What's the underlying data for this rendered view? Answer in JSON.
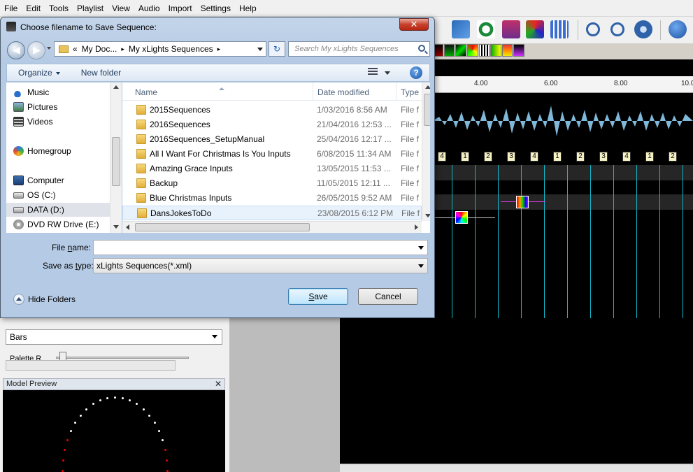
{
  "menubar": {
    "items": [
      "File",
      "Edit",
      "Tools",
      "Playlist",
      "View",
      "Audio",
      "Import",
      "Settings",
      "Help"
    ]
  },
  "timeline": {
    "ruler_labels": [
      "4.00",
      "6.00",
      "8.00",
      "10.0"
    ],
    "timing_marks": [
      "4",
      "1",
      "2",
      "3",
      "4",
      "1",
      "2",
      "3",
      "4",
      "1",
      "2",
      "3"
    ]
  },
  "effect_settings": {
    "effect_type": "Bars",
    "palette_label": "Palette R"
  },
  "model_preview": {
    "title": "Model Preview",
    "close": "✕"
  },
  "dialog": {
    "title": "Choose filename to Save Sequence:",
    "close_glyph": "✕",
    "back_glyph": "◀",
    "fwd_glyph": "▶",
    "address": {
      "overflow": "«",
      "parts": [
        "My Doc...",
        "My xLights Sequences"
      ],
      "sep": "▸"
    },
    "refresh_glyph": "↻",
    "search_placeholder": "Search My xLights Sequences",
    "commands": {
      "organize": "Organize",
      "new_folder": "New folder"
    },
    "help_glyph": "?",
    "nav_items": [
      {
        "label": "Music",
        "icon": "music-icon"
      },
      {
        "label": "Pictures",
        "icon": "pictures-icon"
      },
      {
        "label": "Videos",
        "icon": "videos-icon"
      },
      {
        "label": "Homegroup",
        "icon": "homegroup-icon"
      },
      {
        "label": "Computer",
        "icon": "computer-icon"
      },
      {
        "label": "OS (C:)",
        "icon": "drive-icon"
      },
      {
        "label": "DATA (D:)",
        "icon": "drive-icon"
      },
      {
        "label": "DVD RW Drive (E:)",
        "icon": "dvd-icon"
      }
    ],
    "columns": {
      "name": "Name",
      "date": "Date modified",
      "type": "Type"
    },
    "files": [
      {
        "name": "2015Sequences",
        "date": "1/03/2016 8:56 AM",
        "type": "File f"
      },
      {
        "name": "2016Sequences",
        "date": "21/04/2016 12:53 ...",
        "type": "File f"
      },
      {
        "name": "2016Sequences_SetupManual",
        "date": "25/04/2016 12:17 ...",
        "type": "File f"
      },
      {
        "name": "All I Want For Christmas Is You Inputs",
        "date": "6/08/2015 11:34 AM",
        "type": "File f"
      },
      {
        "name": "Amazing Grace Inputs",
        "date": "13/05/2015 11:53 ...",
        "type": "File f"
      },
      {
        "name": "Backup",
        "date": "11/05/2015 12:11 ...",
        "type": "File f"
      },
      {
        "name": "Blue Christmas Inputs",
        "date": "26/05/2015 9:52 AM",
        "type": "File f"
      },
      {
        "name": "DansJokesToDo",
        "date": "23/08/2015 6:12 PM",
        "type": "File f"
      }
    ],
    "filename_label_pre": "File ",
    "filename_label_u": "n",
    "filename_label_post": "ame:",
    "filename_value": "",
    "saveas_label_pre": "Save as ",
    "saveas_label_u": "t",
    "saveas_label_post": "ype:",
    "saveas_value": "xLights Sequences(*.xml)",
    "hide_folders": "Hide Folders",
    "save_u": "S",
    "save_rest": "ave",
    "cancel": "Cancel"
  },
  "colors": {
    "timeline_line": "#11b8c9",
    "waveform": "#7fb8d8",
    "dialog_frame": "#b5cae4"
  }
}
